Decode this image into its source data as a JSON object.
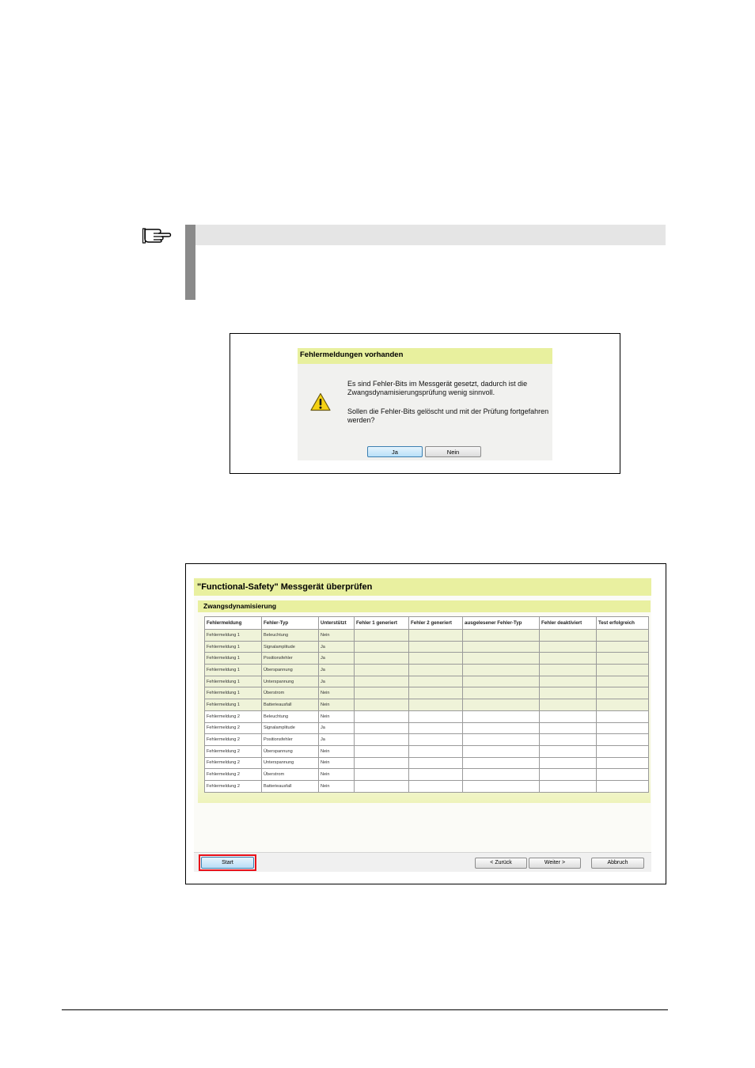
{
  "dialog": {
    "title": "Fehlermeldungen vorhanden",
    "message1": "Es sind Fehler-Bits im Messgerät gesetzt, dadurch ist die Zwangsdynamisierungsprüfung wenig sinnvoll.",
    "message2": "Sollen die Fehler-Bits gelöscht und mit der Prüfung fortgefahren werden?",
    "yes_label": "Ja",
    "no_label": "Nein",
    "icons": {
      "warning": "warning-triangle-icon",
      "note": "pointing-hand-icon"
    }
  },
  "wizard": {
    "title": "\"Functional-Safety\" Messgerät überprüfen",
    "section": "Zwangsdynamisierung",
    "columns": [
      "Fehlermeldung",
      "Fehler-Typ",
      "Unterstützt",
      "Fehler 1 generiert",
      "Fehler 2 generiert",
      "ausgelesener Fehler-Typ",
      "Fehler deaktiviert",
      "Test erfolgreich"
    ],
    "rows": [
      [
        "Fehlermeldung 1",
        "Beleuchtung",
        "Nein",
        "",
        "",
        "",
        "",
        ""
      ],
      [
        "Fehlermeldung 1",
        "Signalamplitude",
        "Ja",
        "",
        "",
        "",
        "",
        ""
      ],
      [
        "Fehlermeldung 1",
        "Positionsfehler",
        "Ja",
        "",
        "",
        "",
        "",
        ""
      ],
      [
        "Fehlermeldung 1",
        "Überspannung",
        "Ja",
        "",
        "",
        "",
        "",
        ""
      ],
      [
        "Fehlermeldung 1",
        "Unterspannung",
        "Ja",
        "",
        "",
        "",
        "",
        ""
      ],
      [
        "Fehlermeldung 1",
        "Überstrom",
        "Nein",
        "",
        "",
        "",
        "",
        ""
      ],
      [
        "Fehlermeldung 1",
        "Batterieausfall",
        "Nein",
        "",
        "",
        "",
        "",
        ""
      ],
      [
        "Fehlermeldung 2",
        "Beleuchtung",
        "Nein",
        "",
        "",
        "",
        "",
        ""
      ],
      [
        "Fehlermeldung 2",
        "Signalamplitude",
        "Ja",
        "",
        "",
        "",
        "",
        ""
      ],
      [
        "Fehlermeldung 2",
        "Positionsfehler",
        "Ja",
        "",
        "",
        "",
        "",
        ""
      ],
      [
        "Fehlermeldung 2",
        "Überspannung",
        "Nein",
        "",
        "",
        "",
        "",
        ""
      ],
      [
        "Fehlermeldung 2",
        "Unterspannung",
        "Nein",
        "",
        "",
        "",
        "",
        ""
      ],
      [
        "Fehlermeldung 2",
        "Überstrom",
        "Nein",
        "",
        "",
        "",
        "",
        ""
      ],
      [
        "Fehlermeldung 2",
        "Batterieausfall",
        "Nein",
        "",
        "",
        "",
        "",
        ""
      ]
    ],
    "buttons": {
      "start": "Start",
      "back": "< Zurück",
      "next": "Weiter >",
      "abort": "Abbruch"
    },
    "colors": {
      "header_band": "#e9f0a0",
      "highlight": "#e8101a",
      "primary_button": "#b9dff7"
    }
  }
}
